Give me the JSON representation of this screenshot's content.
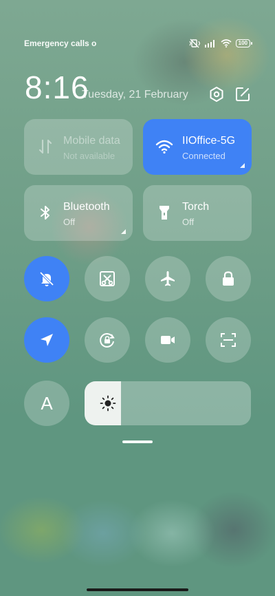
{
  "status_bar": {
    "carrier_text": "Emergency calls o",
    "battery": "100"
  },
  "header": {
    "time": "8:16",
    "date": "Tuesday, 21 February"
  },
  "tiles": {
    "mobile_data": {
      "title": "Mobile data",
      "subtitle": "Not available"
    },
    "wifi": {
      "title": "IIOffice-5G",
      "subtitle": "Connected"
    },
    "bluetooth": {
      "title": "Bluetooth",
      "subtitle": "Off"
    },
    "torch": {
      "title": "Torch",
      "subtitle": "Off"
    }
  },
  "toggles_row1": [
    "mute-icon",
    "screenshot-icon",
    "airplane-icon",
    "lock-icon"
  ],
  "toggles_row2": [
    "location-icon",
    "rotation-lock-icon",
    "video-icon",
    "scan-icon"
  ],
  "font_button": {
    "label": "A"
  },
  "brightness": {
    "level": 0.22
  },
  "colors": {
    "accent": "#3f82f5"
  }
}
